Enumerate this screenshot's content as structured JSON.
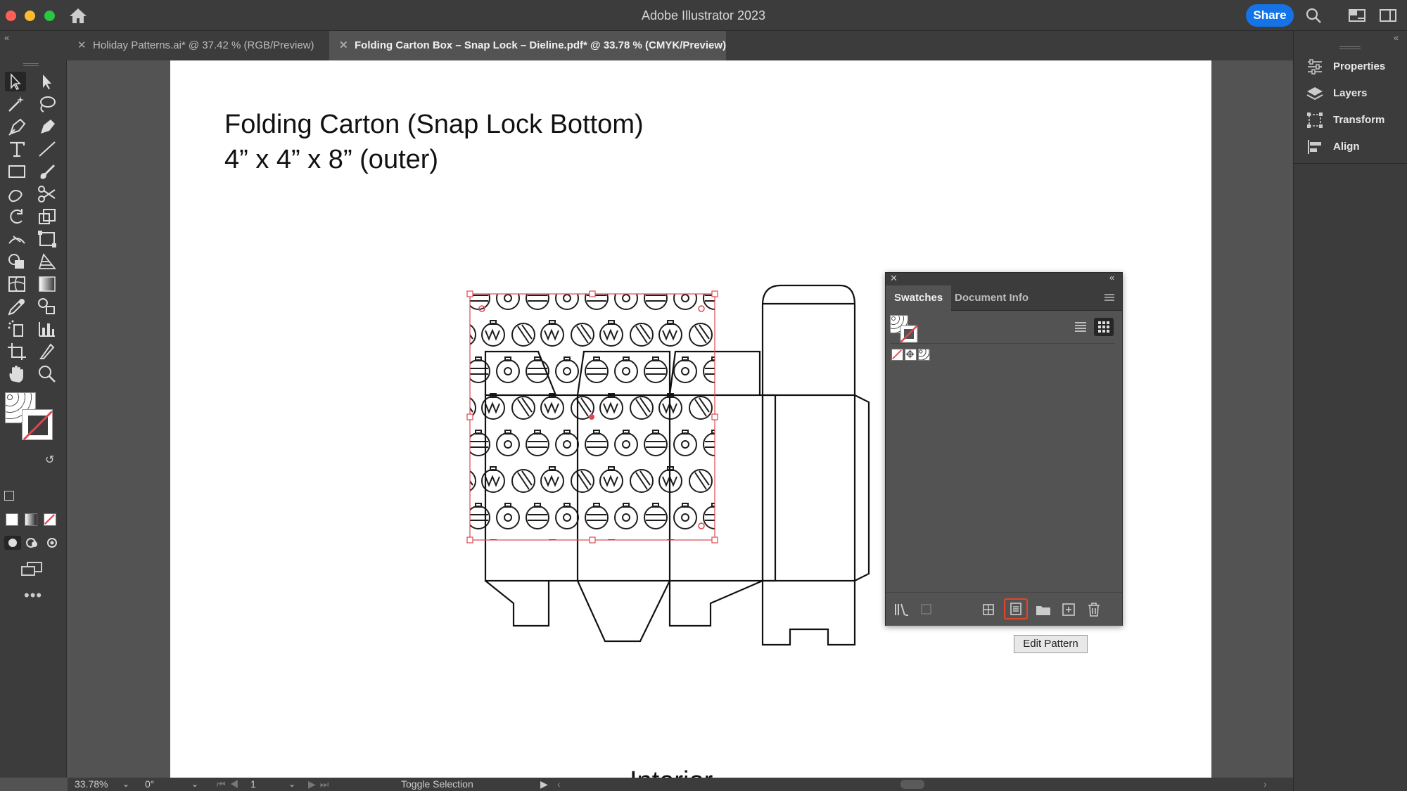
{
  "window": {
    "title": "Adobe Illustrator 2023",
    "share_label": "Share"
  },
  "tabs": [
    {
      "label": "Holiday Patterns.ai* @ 37.42 % (RGB/Preview)",
      "active": false
    },
    {
      "label": "Folding Carton Box – Snap Lock – Dieline.pdf* @ 33.78 % (CMYK/Preview)",
      "active": true
    }
  ],
  "artboard": {
    "title_line1": "Folding Carton (Snap Lock Bottom)",
    "title_line2": "4” x 4” x 8” (outer)",
    "bottom_text": "Interior"
  },
  "right_panel": {
    "items": [
      {
        "label": "Properties",
        "icon": "properties-icon"
      },
      {
        "label": "Layers",
        "icon": "layers-icon"
      },
      {
        "label": "Transform",
        "icon": "transform-icon"
      },
      {
        "label": "Align",
        "icon": "align-icon"
      }
    ]
  },
  "swatches_panel": {
    "tabs": [
      {
        "label": "Swatches",
        "active": true
      },
      {
        "label": "Document Info",
        "active": false
      }
    ],
    "tooltip": "Edit Pattern",
    "footer_buttons": [
      "swatch-libraries-icon",
      "place-swatch-icon",
      "show-swatch-kinds-icon",
      "edit-pattern-icon",
      "new-color-group-icon",
      "new-swatch-icon",
      "delete-swatch-icon"
    ]
  },
  "statusbar": {
    "zoom": "33.78%",
    "rotation": "0°",
    "artboard_number": "1",
    "mode": "Toggle Selection"
  },
  "colors": {
    "chrome": "#3c3c3c",
    "canvas": "#535353",
    "accent": "#1473e6",
    "selection": "#e0464e"
  }
}
